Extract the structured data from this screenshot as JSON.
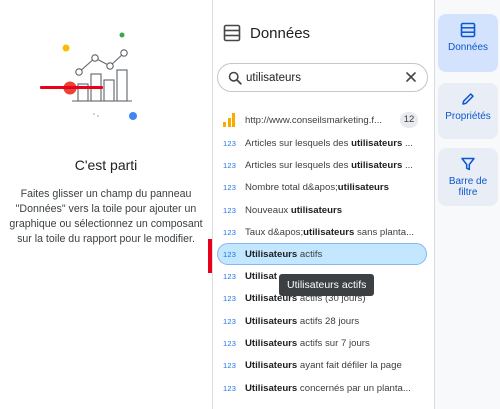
{
  "empty_state": {
    "title": "C'est parti",
    "description": "Faites glisser un champ du panneau \"Données\" vers la toile pour ajouter un graphique ou sélectionnez un composant sur la toile du rapport pour le modifier."
  },
  "data_panel": {
    "title": "Données",
    "search": {
      "value": "utilisateurs",
      "placeholder": ""
    },
    "source": {
      "name": "http://www.conseilsmarketing.f...",
      "count": "12"
    },
    "fields": [
      {
        "type": "123",
        "pre": "Articles sur lesquels des ",
        "bold": "utilisateurs",
        "post": " ..."
      },
      {
        "type": "123",
        "pre": "Articles sur lesquels des ",
        "bold": "utilisateurs",
        "post": " ..."
      },
      {
        "type": "123",
        "pre": "Nombre total d&apos;",
        "bold": "utilisateurs",
        "post": ""
      },
      {
        "type": "123",
        "pre": "Nouveaux ",
        "bold": "utilisateurs",
        "post": ""
      },
      {
        "type": "123",
        "pre": "Taux d&apos;",
        "bold": "utilisateurs",
        "post": " sans planta..."
      },
      {
        "type": "123",
        "pre": "",
        "bold": "Utilisateurs",
        "post": " actifs"
      },
      {
        "type": "123",
        "pre": "",
        "bold": "Utilisat",
        "post": ""
      },
      {
        "type": "123",
        "pre": "",
        "bold": "Utilisateurs",
        "post": " actifs (30 jours)"
      },
      {
        "type": "123",
        "pre": "",
        "bold": "Utilisateurs",
        "post": " actifs 28 jours"
      },
      {
        "type": "123",
        "pre": "",
        "bold": "Utilisateurs",
        "post": " actifs sur 7 jours"
      },
      {
        "type": "123",
        "pre": "",
        "bold": "Utilisateurs",
        "post": " ayant fait défiler la page"
      },
      {
        "type": "123",
        "pre": "",
        "bold": "Utilisateurs",
        "post": " concernés par un planta..."
      }
    ],
    "selected_index": 5,
    "tooltip": "Utilisateurs actifs"
  },
  "rail": {
    "data_label": "Données",
    "properties_label": "Propriétés",
    "filter_label": "Barre de filtre"
  },
  "colors": {
    "accent": "#1a73e8",
    "rail_active": "#d3e3fd",
    "selected_row": "#c2e7ff",
    "annotation_red": "#e8001c"
  }
}
